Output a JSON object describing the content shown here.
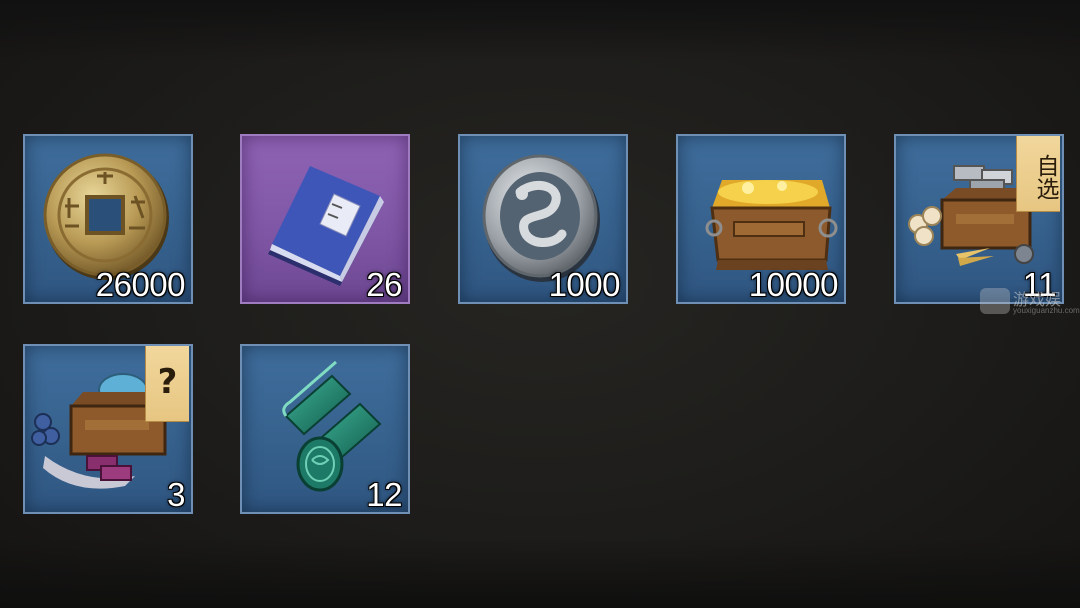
{
  "inventory": {
    "items": [
      {
        "icon": "copper-coin-icon",
        "quantity": "26000",
        "rarity": "blue"
      },
      {
        "icon": "blue-book-icon",
        "quantity": "26",
        "rarity": "purple"
      },
      {
        "icon": "jade-dragon-medallion-icon",
        "quantity": "1000",
        "rarity": "blue"
      },
      {
        "icon": "gold-treasure-chest-icon",
        "quantity": "10000",
        "rarity": "blue"
      },
      {
        "icon": "resource-selection-chest-icon",
        "quantity": "11",
        "rarity": "blue",
        "tag": "自选"
      },
      {
        "icon": "mystery-supply-chest-icon",
        "quantity": "3",
        "rarity": "blue",
        "tag": "?"
      },
      {
        "icon": "green-scroll-seal-icon",
        "quantity": "12",
        "rarity": "blue"
      }
    ]
  },
  "watermark": {
    "text": "游戏娱",
    "url": "youxiguanzhu.com"
  },
  "colors": {
    "slot_blue": "#3f6d9c",
    "slot_purple": "#8f63b5",
    "tag_gold": "#f1d79c",
    "background": "#1d1c1a"
  }
}
